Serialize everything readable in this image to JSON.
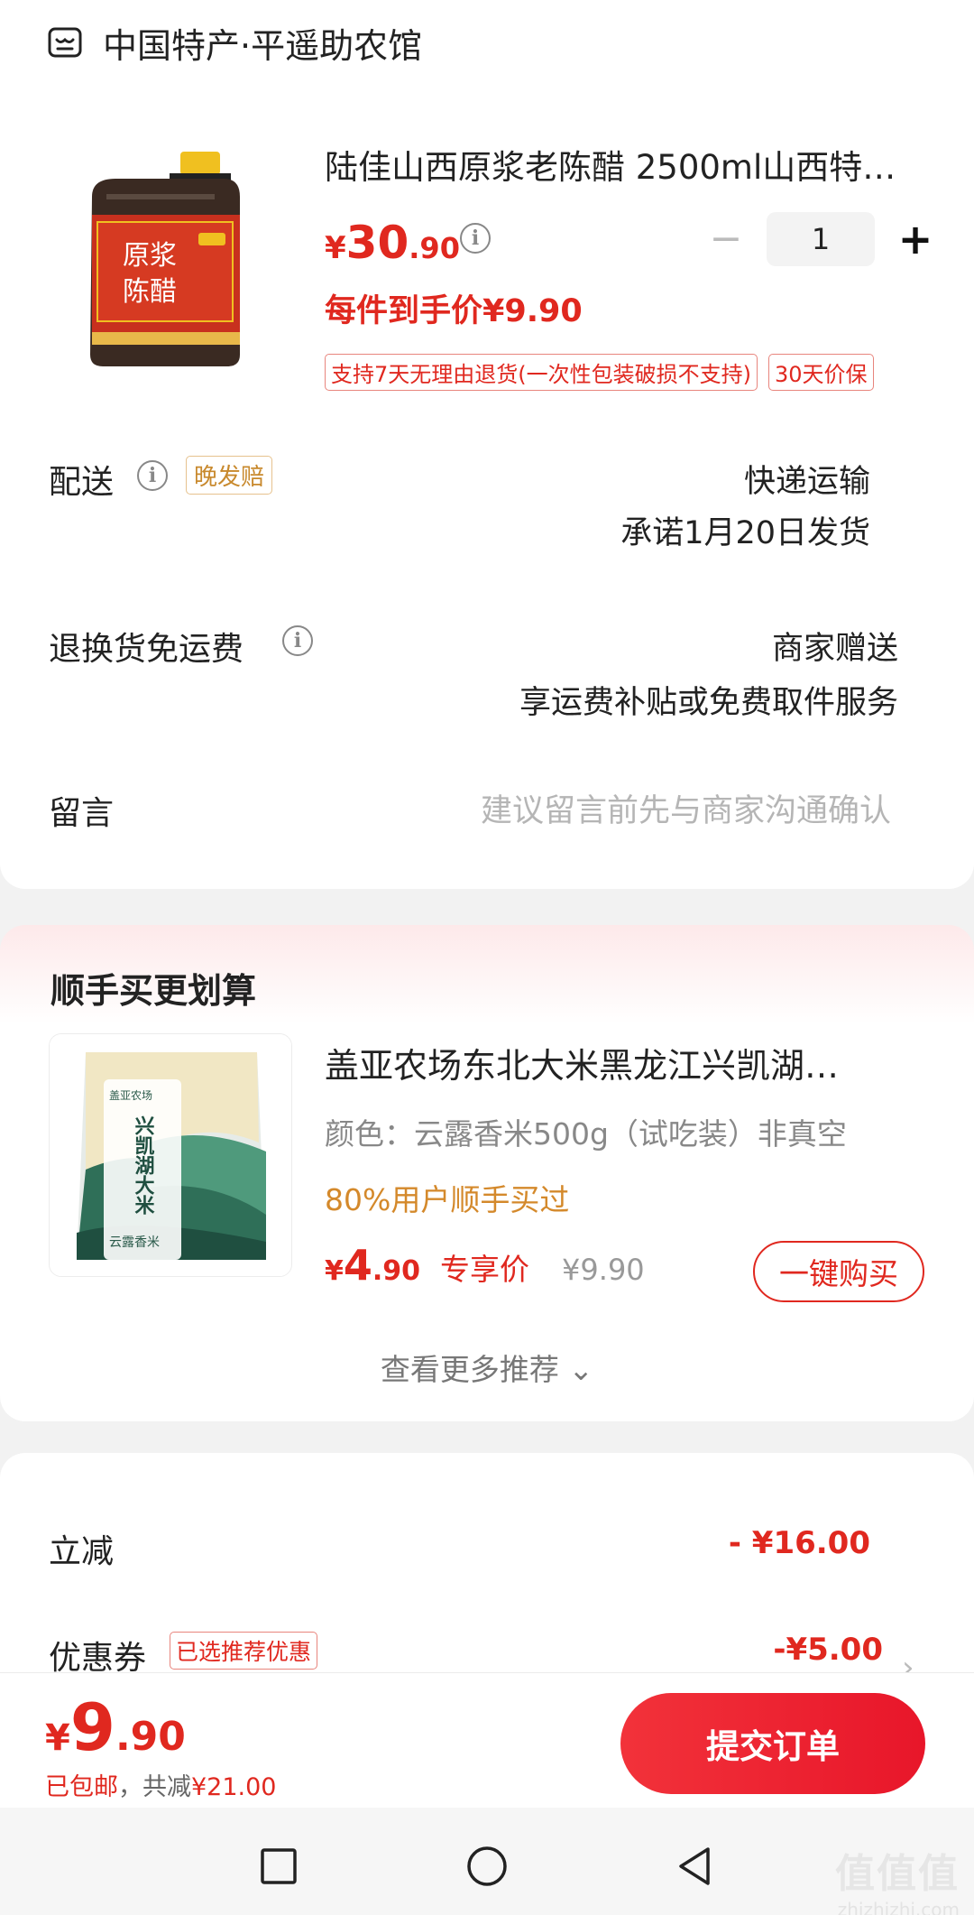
{
  "shop": {
    "name": "中国特产·平遥助农馆",
    "icon": "store-icon"
  },
  "product": {
    "title": "陆佳山西原浆老陈醋 2500ml山西特…",
    "image_label_top": "原浆",
    "image_label_bottom": "陈醋",
    "price_yen": "¥",
    "price_int": "30",
    "price_dec": ".90",
    "quantity": "1",
    "deal_price": "每件到手价¥9.90",
    "tags": [
      "支持7天无理由退货(一次性包装破损不支持)",
      "30天价保"
    ]
  },
  "delivery": {
    "label": "配送",
    "tag": "晚发赔",
    "method": "快递运输",
    "promise": "承诺1月20日发货"
  },
  "return_shipping": {
    "label": "退换货免运费",
    "value_line1": "商家赠送",
    "value_line2": "享运费补贴或免费取件服务"
  },
  "message": {
    "label": "留言",
    "placeholder": "建议留言前先与商家沟通确认"
  },
  "recommend": {
    "title": "顺手买更划算",
    "item": {
      "name": "盖亚农场东北大米黑龙江兴凯湖…",
      "spec": "颜色：云露香米500g（试吃装）非真空",
      "bought": "80%用户顺手买过",
      "price_yen": "¥",
      "price_int": "4",
      "price_dec": ".90",
      "price_label": "专享价",
      "original_price": "¥9.90",
      "buy_label": "一键购买",
      "image_brand": "盖亚农场",
      "image_title": "兴凯湖大米",
      "image_sub": "云露香米"
    },
    "more": "查看更多推荐 ⌄"
  },
  "summary": {
    "discount_label": "立减",
    "discount_value": "- ¥16.00",
    "coupon_label": "优惠券",
    "coupon_tag": "已选推荐优惠",
    "coupon_value": "-¥5.00"
  },
  "footer": {
    "total_yen": "¥",
    "total_int": "9",
    "total_dec": ".90",
    "free_shipping": "已包邮",
    "separator": "，共减",
    "saved": "¥21.00",
    "submit": "提交订单"
  },
  "watermark": {
    "logo": "值值值",
    "url": "zhizhizhi.com"
  },
  "colors": {
    "accent": "#e0281f",
    "gold": "#d4892b"
  }
}
